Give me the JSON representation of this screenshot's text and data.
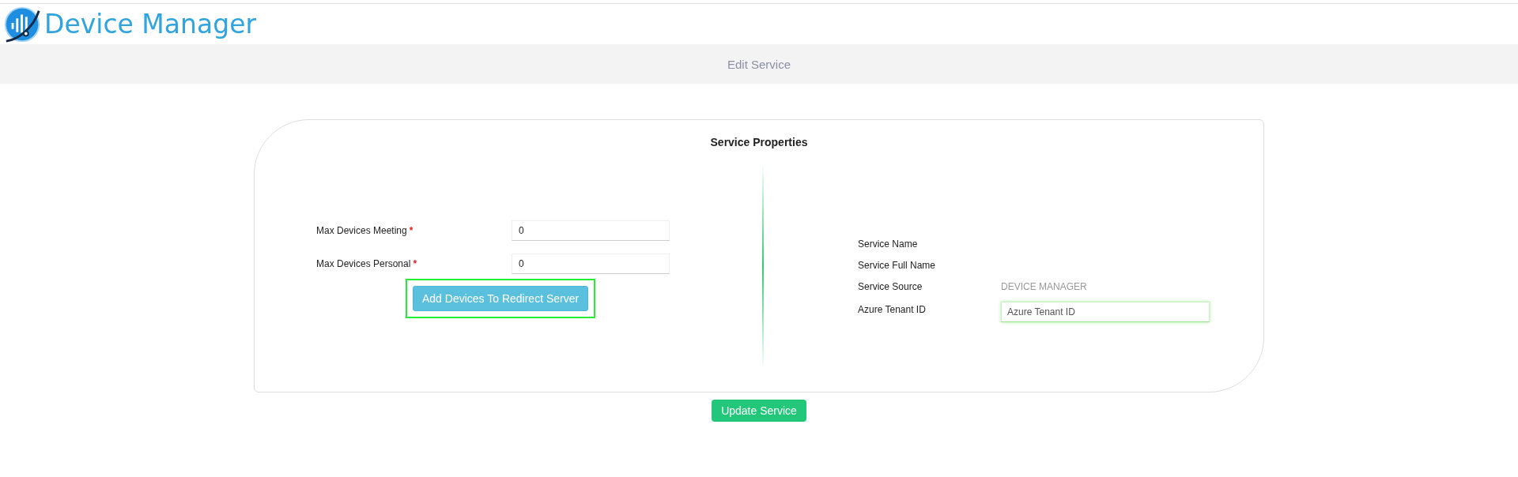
{
  "app": {
    "title": "Device Manager"
  },
  "page_bar": {
    "title": "Edit Service"
  },
  "card": {
    "title": "Service Properties",
    "left_fields": [
      {
        "label": "Max Devices Meeting",
        "required_mark": "*",
        "value": "0"
      },
      {
        "label": "Max Devices Personal",
        "required_mark": "*",
        "value": "0"
      }
    ],
    "left_button": {
      "label": "Add Devices To Redirect Server",
      "highlighted": true
    },
    "right_fields": [
      {
        "kind": "static",
        "label": "Service Name"
      },
      {
        "kind": "static",
        "label": "Service Full Name"
      },
      {
        "kind": "static",
        "label": "Service Source",
        "value": "DEVICE MANAGER"
      },
      {
        "kind": "input",
        "label": "Azure Tenant ID",
        "placeholder": "Azure Tenant ID",
        "focused": true
      }
    ]
  },
  "submit_button": {
    "label": "Update Service"
  }
}
